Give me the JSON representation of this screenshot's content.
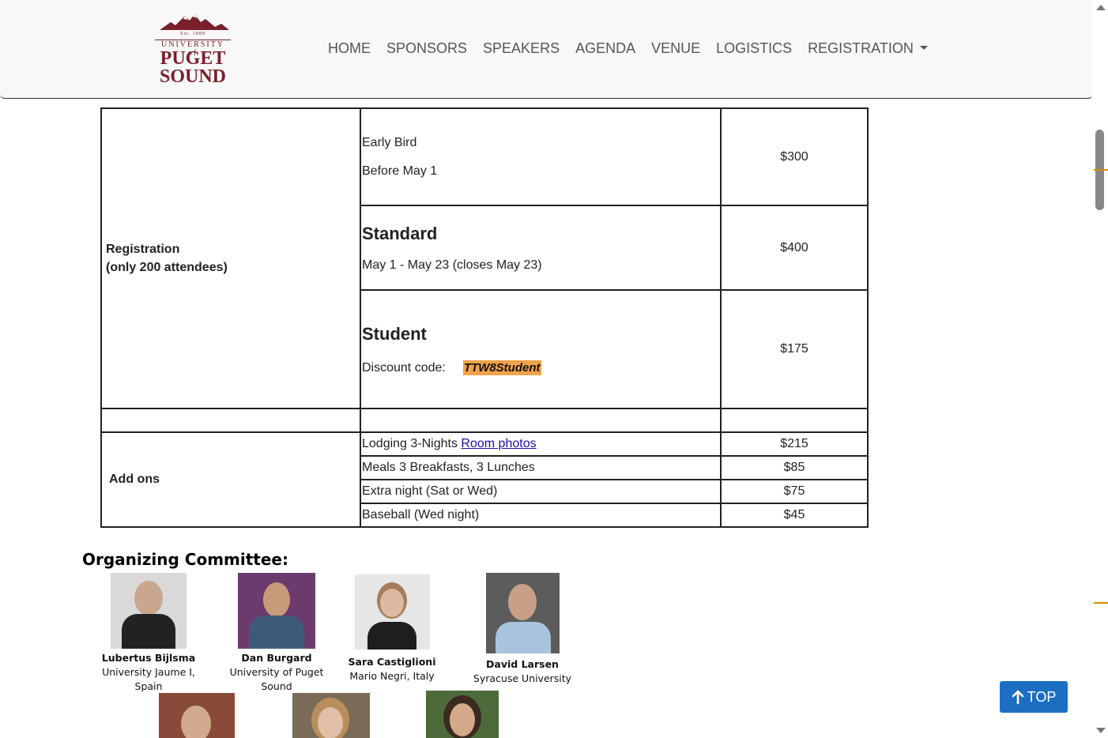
{
  "header": {
    "logo": {
      "est": "Est. 1888",
      "university_line": "UNIVERSITY of",
      "puget": "PUGET",
      "sound": "SOUND",
      "icon": "mountain-icon",
      "brand_color": "#7a1f2b"
    },
    "nav": [
      "HOME",
      "SPONSORS",
      "SPEAKERS",
      "AGENDA",
      "VENUE",
      "LOGISTICS",
      "REGISTRATION"
    ]
  },
  "pricing": {
    "registration_label_1": "Registration",
    "registration_label_2": "(only 200 attendees)",
    "tiers": [
      {
        "title": "Early Bird",
        "subtitle": "Before May 1",
        "price": "$300"
      },
      {
        "title": "Standard",
        "subtitle": "May 1 - May 23 (closes May 23)",
        "price": "$400"
      },
      {
        "title": "Student",
        "subtitle": "Discount code:",
        "code": "TTW8Student",
        "price": "$175"
      }
    ],
    "addons_label": "Add ons",
    "addons": [
      {
        "desc": "Lodging 3-Nights ",
        "link": "Room photos",
        "price": "$215"
      },
      {
        "desc": "Meals 3 Breakfasts, 3 Lunches",
        "price": "$85"
      },
      {
        "desc": "Extra night (Sat or Wed)",
        "price": "$75"
      },
      {
        "desc": "Baseball (Wed night)",
        "price": "$45"
      }
    ],
    "code_highlight_color": "#f0a24a"
  },
  "committee": {
    "title": "Organizing Committee:",
    "members": [
      {
        "name": "Lubertus Bijlsma",
        "affiliation": "University Jaume I, Spain"
      },
      {
        "name": "Dan Burgard",
        "affiliation": "University of Puget Sound"
      },
      {
        "name": "Sara Castiglioni",
        "affiliation": "Mario Negri, Italy"
      },
      {
        "name": "David Larsen",
        "affiliation": "Syracuse University"
      }
    ]
  },
  "top_button": {
    "label": "TOP",
    "icon": "arrow-up-icon",
    "color": "#1b6ec2"
  }
}
